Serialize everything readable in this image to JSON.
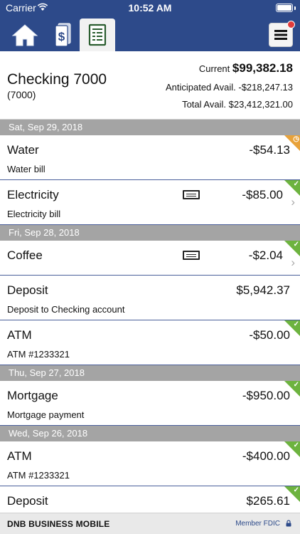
{
  "status_bar": {
    "carrier": "Carrier",
    "time": "10:52 AM"
  },
  "nav": {
    "tabs": [
      {
        "name": "home",
        "icon": "home-icon"
      },
      {
        "name": "accounts",
        "icon": "money-icon"
      },
      {
        "name": "transactions",
        "icon": "ledger-icon",
        "active": true
      }
    ],
    "menu_icon": "hamburger-icon"
  },
  "account": {
    "name": "Checking 7000",
    "number": "(7000)",
    "current_label": "Current",
    "current_value": "$99,382.18",
    "anticipated_label": "Anticipated Avail.",
    "anticipated_value": "-$218,247.13",
    "total_label": "Total Avail.",
    "total_value": "$23,412,321.00"
  },
  "groups": [
    {
      "date": "Sat, Sep 29, 2018",
      "items": [
        {
          "title": "Water",
          "amount": "-$54.13",
          "desc": "Water bill",
          "status": "pending"
        },
        {
          "title": "Electricity",
          "amount": "-$85.00",
          "desc": "Electricity bill",
          "status": "cleared"
        }
      ]
    },
    {
      "date": "Fri, Sep 28, 2018",
      "items": [
        {
          "title": "Coffee",
          "amount": "-$2.04",
          "desc": "",
          "status": "cleared"
        },
        {
          "title": "Deposit",
          "amount": "$5,942.37",
          "desc": "Deposit to Checking account",
          "status": "none"
        },
        {
          "title": "ATM",
          "amount": "-$50.00",
          "desc": "ATM #1233321",
          "status": "cleared"
        }
      ]
    },
    {
      "date": "Thu, Sep 27, 2018",
      "items": [
        {
          "title": "Mortgage",
          "amount": "-$950.00",
          "desc": "Mortgage payment",
          "status": "cleared"
        }
      ]
    },
    {
      "date": "Wed, Sep 26, 2018",
      "items": [
        {
          "title": "ATM",
          "amount": "-$400.00",
          "desc": "ATM #1233321",
          "status": "cleared"
        },
        {
          "title": "Deposit",
          "amount": "$265.61",
          "desc": "",
          "status": "cleared"
        }
      ]
    }
  ],
  "footer": {
    "brand": "DNB BUSINESS MOBILE",
    "fdic": "Member FDIC"
  },
  "colors": {
    "brand_blue": "#2d4a8a",
    "cleared_green": "#6db33f",
    "pending_orange": "#e8a23a",
    "date_header_gray": "#a4a4a4"
  }
}
